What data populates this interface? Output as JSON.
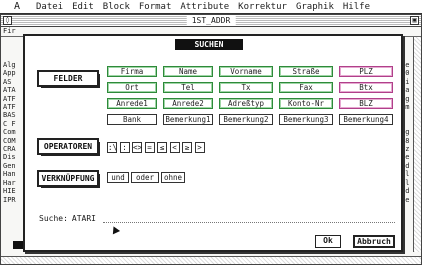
{
  "menubar": {
    "atari_glyph": "A",
    "items": [
      "Datei",
      "Edit",
      "Block",
      "Format",
      "Attribute",
      "Korrektur",
      "Graphik",
      "Hilfe"
    ]
  },
  "background_window": {
    "title": "1ST_ADDR",
    "row2": "Fir",
    "left_column_text": [
      "Alg",
      "App",
      "AS",
      "ATA",
      "ATF",
      "ATF",
      "BAS",
      "C F",
      "Com",
      "COM",
      "CRA",
      "Dis",
      "Gen",
      "Han",
      "Har",
      "HIE",
      "IPR"
    ],
    "right_column_text": [
      "2e",
      "90",
      "2i",
      "ja",
      "ng",
      "em",
      "",
      "",
      "rg",
      "58",
      "nz",
      "de",
      "nd",
      "sl",
      "ll",
      "nd",
      "he"
    ]
  },
  "dialog": {
    "title": "SUCHEN",
    "felder_label": "FELDER",
    "fields": [
      [
        "Firma",
        "Name",
        "Vorname",
        "Straße",
        "PLZ"
      ],
      [
        "Ort",
        "Tel",
        "Tx",
        "Fax",
        "Btx"
      ],
      [
        "Anrede1",
        "Anrede2",
        "Adreßtyp",
        "Konto-Nr",
        "BLZ"
      ],
      [
        "Bank",
        "Bemerkung1",
        "Bemerkung2",
        "Bemerkung3",
        "Bemerkung4"
      ]
    ],
    "operatoren_label": "OPERATOREN",
    "operators": [
      ":\\",
      ":",
      "<>",
      "=",
      "≤",
      "<",
      "≥",
      ">"
    ],
    "verknuepfung_label": "VERKNÜPFUNG",
    "connectors": [
      "und",
      "oder",
      "ohne"
    ],
    "search_label": "Suche:",
    "search_value": "ATARI",
    "ok_label": "Ok",
    "cancel_label": "Abbruch"
  }
}
